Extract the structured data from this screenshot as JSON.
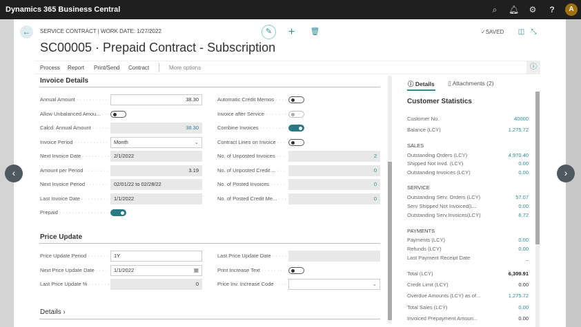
{
  "topbar": {
    "app_title": "Dynamics 365 Business Central",
    "avatar": "A",
    "icons": [
      "search-icon",
      "bell-icon",
      "gear-icon",
      "help-icon"
    ]
  },
  "header": {
    "caption": "SERVICE CONTRACT | WORK DATE: 1/27/2022",
    "title": "SC00005 · Prepaid Contract - Subscription",
    "saved": "✓SAVED"
  },
  "actions": [
    "Process",
    "Report",
    "Print/Send",
    "Contract",
    "More options"
  ],
  "invoice": {
    "title": "Invoice Details",
    "left": [
      {
        "label": "Annual Amount",
        "value": "38.30",
        "type": "input",
        "align": "num"
      },
      {
        "label": "Allow Unbalanced Amou...",
        "type": "toggle",
        "on": false
      },
      {
        "label": "Calcd. Annual Amount",
        "value": "38.30",
        "type": "ro",
        "align": "num",
        "teal": true
      },
      {
        "label": "Invoice Period",
        "value": "Month",
        "type": "select"
      },
      {
        "label": "Next Invoice Date",
        "value": "2/1/2022",
        "type": "ro"
      },
      {
        "label": "Amount per Period",
        "value": "3.19",
        "type": "ro",
        "align": "num"
      },
      {
        "label": "Next Invoice Period",
        "value": "02/01/22 to 02/28/22",
        "type": "ro"
      },
      {
        "label": "Last Invoice Date",
        "value": "1/1/2022",
        "type": "ro"
      },
      {
        "label": "Prepaid",
        "type": "toggle",
        "on": true
      }
    ],
    "right": [
      {
        "label": "Automatic Credit Memos",
        "type": "toggle",
        "on": false
      },
      {
        "label": "Invoice after Service",
        "type": "toggle",
        "on": false,
        "disabled": true
      },
      {
        "label": "Combine Invoices",
        "type": "toggle",
        "on": true
      },
      {
        "label": "Contract Lines on Invoice",
        "type": "toggle",
        "on": false
      },
      {
        "label": "No. of Unposted Invoices",
        "value": "2",
        "type": "ro",
        "align": "num",
        "teal": true
      },
      {
        "label": "No. of Unposted Credit ...",
        "value": "0",
        "type": "ro",
        "align": "num",
        "teal": true
      },
      {
        "label": "No. of Posted Invoices",
        "value": "0",
        "type": "ro",
        "align": "num",
        "teal": true
      },
      {
        "label": "No. of Posted Credit Me...",
        "value": "0",
        "type": "ro",
        "align": "num",
        "teal": true
      }
    ]
  },
  "price": {
    "title": "Price Update",
    "left": [
      {
        "label": "Price Update Period",
        "value": "1Y",
        "type": "input"
      },
      {
        "label": "Next Price Update Date",
        "value": "1/1/2022",
        "type": "date"
      },
      {
        "label": "Last Price Update %",
        "value": "0",
        "type": "ro",
        "align": "num"
      }
    ],
    "right": [
      {
        "label": "Last Price Update Date",
        "value": "",
        "type": "ro"
      },
      {
        "label": "Print Increase Text",
        "type": "toggle",
        "on": false
      },
      {
        "label": "Price Inv. Increase Code",
        "value": "",
        "type": "select"
      }
    ]
  },
  "details_section": "Details",
  "factbox": {
    "tabs": [
      "Details",
      "Attachments (2)"
    ],
    "title": "Customer Statistics",
    "rows": [
      {
        "label": "Customer No.",
        "value": "40000"
      },
      {
        "label": "Balance (LCY)",
        "value": "1,275.72"
      },
      {
        "header": "SALES"
      },
      {
        "label": "Outstanding Orders (LCY)",
        "value": "4,970.40"
      },
      {
        "label": "Shipped Not Invd. (LCY)",
        "value": "0.00"
      },
      {
        "label": "Outstanding Invoices (LCY)",
        "value": "0.00"
      },
      {
        "header": "SERVICE"
      },
      {
        "label": "Outstanding Serv. Orders (LCY)",
        "value": "57.07"
      },
      {
        "label": "Serv Shipped Not Invoiced(L...",
        "value": "0.00"
      },
      {
        "label": "Outstanding Serv.Invoices(LCY)",
        "value": "6.72"
      },
      {
        "header": "PAYMENTS"
      },
      {
        "label": "Payments (LCY)",
        "value": "0.00"
      },
      {
        "label": "Refunds (LCY)",
        "value": "0.00"
      },
      {
        "label": "Last Payment Receipt Date",
        "value": "_"
      },
      {
        "label": "Total (LCY)",
        "value": "6,309.91",
        "bold": true
      },
      {
        "label": "Credit Limit (LCY)",
        "value": "0.00",
        "plain": true
      },
      {
        "label": "Overdue Amounts (LCY) as of...",
        "value": "1,275.72"
      },
      {
        "label": "Total Sales (LCY)",
        "value": "0.00"
      },
      {
        "label": "Invoiced Prepayment Amoun...",
        "value": "0.00",
        "plain": true
      }
    ]
  }
}
